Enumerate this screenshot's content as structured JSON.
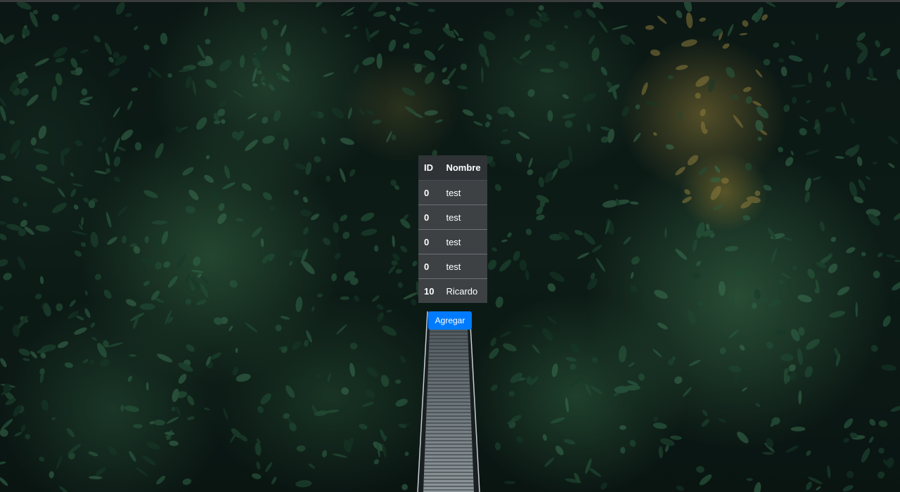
{
  "table": {
    "headers": [
      "ID",
      "Nombre"
    ],
    "rows": [
      {
        "id": "0",
        "nombre": "test"
      },
      {
        "id": "0",
        "nombre": "test"
      },
      {
        "id": "0",
        "nombre": "test"
      },
      {
        "id": "0",
        "nombre": "test"
      },
      {
        "id": "10",
        "nombre": "Ricardo"
      }
    ]
  },
  "actions": {
    "add_label": "Agregar"
  },
  "colors": {
    "button": "#007bff",
    "table_bg": "#343a40"
  }
}
